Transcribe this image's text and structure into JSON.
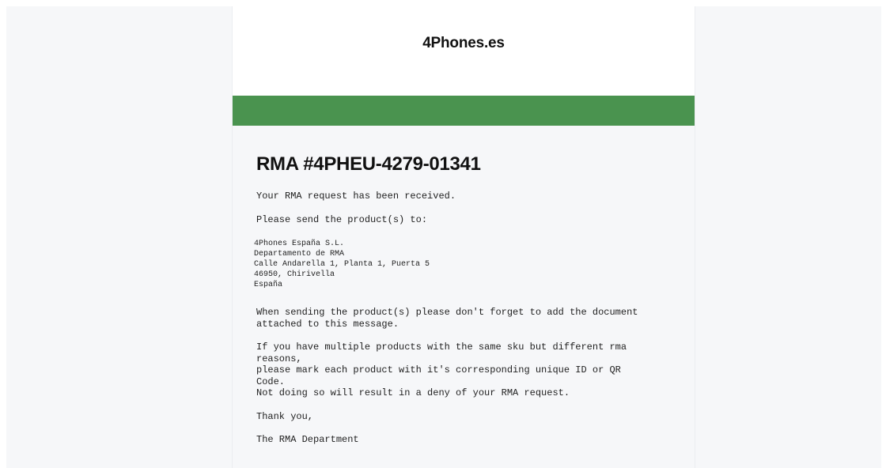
{
  "header": {
    "brand": "4Phones.es"
  },
  "content": {
    "rma_title": "RMA #4PHEU-4279-01341",
    "received_text": "Your RMA request has been received.",
    "send_to_text": "Please send the product(s) to:",
    "address_lines": [
      "4Phones España S.L.",
      "Departamento de RMA",
      "Calle Andarella 1, Planta 1, Puerta 5",
      "46950, Chirivella",
      "España"
    ],
    "document_notice": "When sending the product(s) please don't forget to add the document\nattached to this message.",
    "multiple_products_notice": "If you have multiple products with the same sku but different rma\nreasons,\nplease mark each product with it's corresponding unique ID or QR\nCode.\nNot doing so will result in a deny of your RMA request.",
    "thanks": "Thank you,",
    "signature": "The RMA Department"
  },
  "colors": {
    "accent_band": "#4a934f",
    "page_background": "#f6f7f9"
  }
}
